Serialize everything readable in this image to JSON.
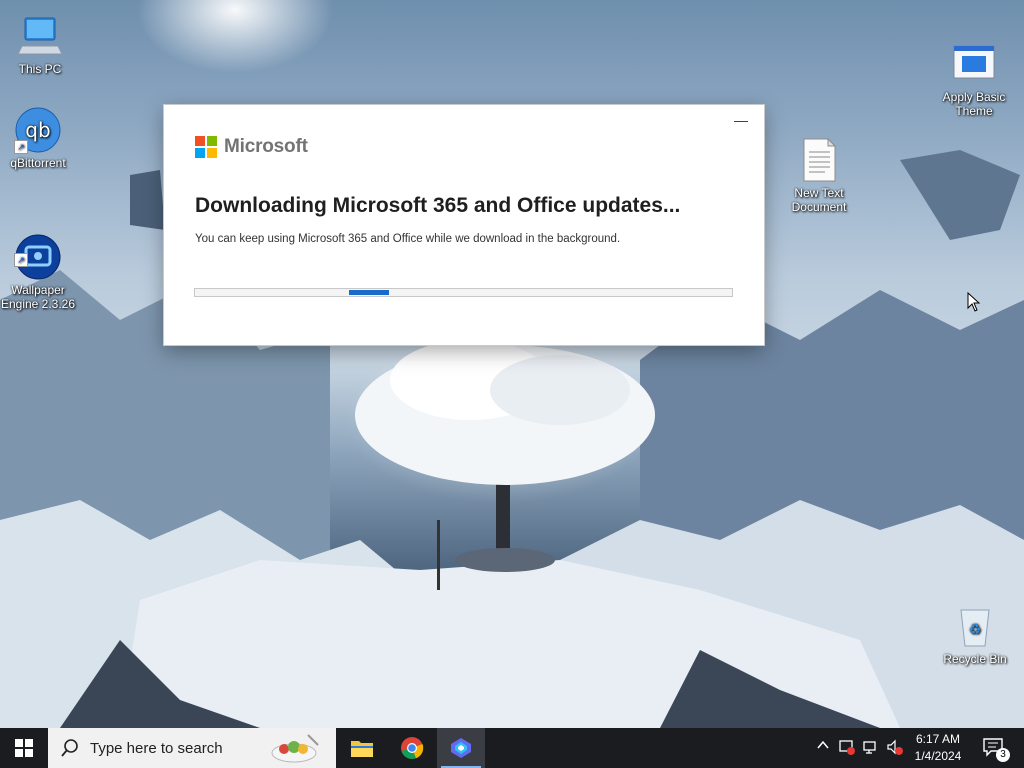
{
  "desktop": {
    "icons": [
      {
        "label": "This PC",
        "icon": "computer-icon"
      },
      {
        "label": "qBittorrent",
        "icon": "qbittorrent-icon"
      },
      {
        "label": "Wallpaper\nEngine 2.3.26",
        "icon": "wallpaper-engine-icon"
      },
      {
        "label": "Apply Basic\nTheme",
        "icon": "theme-window-icon"
      },
      {
        "label": "New Text\nDocument",
        "icon": "text-document-icon"
      },
      {
        "label": "Recycle Bin",
        "icon": "recycle-bin-icon"
      }
    ]
  },
  "dialog": {
    "brand": "Microsoft",
    "title": "Downloading Microsoft 365 and Office updates...",
    "subtitle": "You can keep using Microsoft 365 and Office while we download in the background.",
    "minimize_label": "—",
    "progress_indeterminate": true,
    "colors": {
      "red": "#f25022",
      "green": "#7fba00",
      "blue": "#00a4ef",
      "yellow": "#ffb900",
      "progress": "#1b6ac9"
    }
  },
  "taskbar": {
    "search_placeholder": "Type here to search",
    "apps": [
      {
        "name": "File Explorer",
        "icon": "folder-icon"
      },
      {
        "name": "Google Chrome",
        "icon": "chrome-icon"
      },
      {
        "name": "Microsoft 365",
        "icon": "copilot-icon"
      }
    ],
    "clock": {
      "time": "6:17 AM",
      "date": "1/4/2024"
    },
    "notifications_count": "3"
  }
}
